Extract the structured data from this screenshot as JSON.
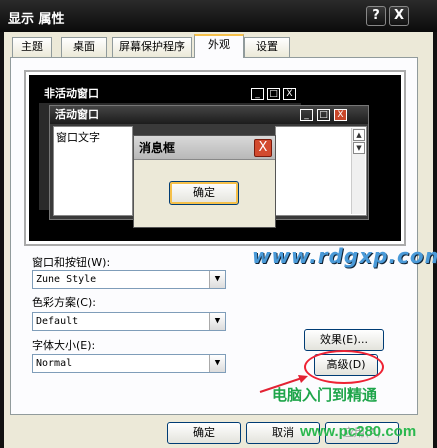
{
  "window": {
    "title": "显示 属性",
    "help_glyph": "?",
    "close_glyph": "X"
  },
  "tabs": [
    {
      "label": "主题",
      "active": false
    },
    {
      "label": "桌面",
      "active": false
    },
    {
      "label": "屏幕保护程序",
      "active": false
    },
    {
      "label": "外观",
      "active": true
    },
    {
      "label": "设置",
      "active": false
    }
  ],
  "preview": {
    "inactive_title": "非活动窗口",
    "active_title": "活动窗口",
    "window_text": "窗口文字",
    "messagebox_title": "消息框",
    "messagebox_ok": "确定",
    "min_glyph": "_",
    "max_glyph": "□",
    "close_glyph": "X",
    "scroll_up": "▲",
    "scroll_down": "▼"
  },
  "form": {
    "windows_buttons_label": "窗口和按钮(W):",
    "windows_buttons_value": "Zune Style",
    "color_scheme_label": "色彩方案(C):",
    "color_scheme_value": "Default",
    "font_size_label": "字体大小(E):",
    "font_size_value": "Normal",
    "dropdown_arrow": "▼"
  },
  "buttons": {
    "effects": "效果(E)...",
    "advanced": "高级(D)",
    "ok": "确定",
    "cancel": "取消",
    "apply": "应用(A)"
  },
  "watermarks": {
    "site1": "www.rdgxp.com",
    "caption": "电脑入门到精通",
    "site2": "www.pc280.com"
  },
  "colors": {
    "accent_orange": "#f5c04a",
    "annotation_red": "#e22233",
    "watermark_green": "#1ea54a"
  }
}
